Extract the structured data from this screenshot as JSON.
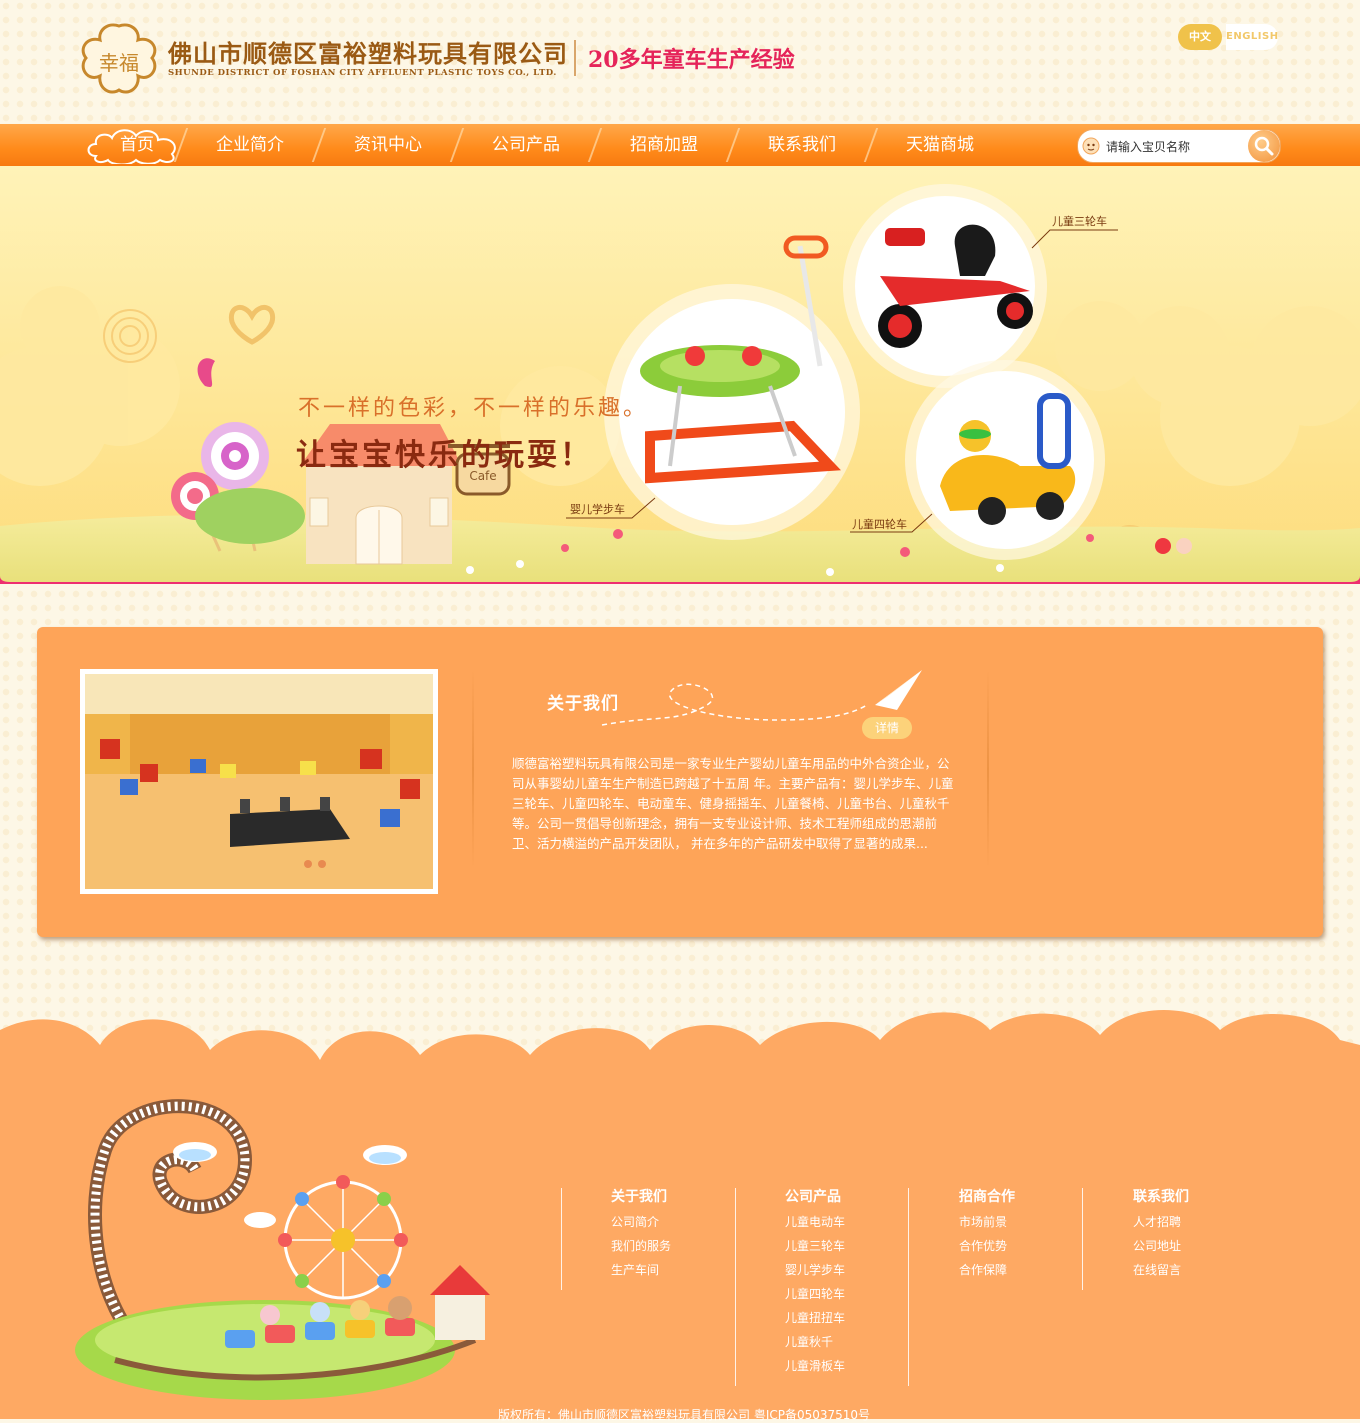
{
  "header": {
    "logo_text": "幸福",
    "company_cn": "佛山市顺德区富裕塑料玩具有限公司",
    "company_en": "SHUNDE DISTRICT OF FOSHAN CITY AFFLUENT PLASTIC TOYS CO., LTD.",
    "slogan": "20多年童车生产经验",
    "lang_cn": "中文",
    "lang_en": "ENGLISH"
  },
  "nav": {
    "items": [
      "首页",
      "企业简介",
      "资讯中心",
      "公司产品",
      "招商加盟",
      "联系我们",
      "天猫商城"
    ],
    "active_index": 0,
    "search_placeholder": "请输入宝贝名称"
  },
  "banner": {
    "line1": "不一样的色彩，不一样的乐趣。",
    "line2": "让宝宝快乐的玩耍！",
    "cafe_sign": "Cafe",
    "labels": {
      "tricycle": "儿童三轮车",
      "walker": "婴儿学步车",
      "four_wheel": "儿童四轮车"
    },
    "active_slide": 0,
    "slide_count": 2
  },
  "about": {
    "title": "关于我们",
    "detail_button": "详情",
    "text": "顺德富裕塑料玩具有限公司是一家专业生产婴幼儿童车用品的中外合资企业，公司从事婴幼儿童车生产制造已跨越了十五周 年。主要产品有：婴儿学步车、儿童三轮车、儿童四轮车、电动童车、健身摇摇车、儿童餐椅、儿童书台、儿童秋千等。公司一贯倡导创新理念，拥有一支专业设计师、技术工程师组成的思潮前卫、活力横溢的产品开发团队， 并在多年的产品研发中取得了显著的成果..."
  },
  "footer": {
    "columns": [
      {
        "title": "关于我们",
        "links": [
          "公司简介",
          "我们的服务",
          "生产车间"
        ]
      },
      {
        "title": "公司产品",
        "links": [
          "儿童电动车",
          "儿童三轮车",
          "婴儿学步车",
          "儿童四轮车",
          "儿童扭扭车",
          "儿童秋千",
          "儿童滑板车"
        ]
      },
      {
        "title": "招商合作",
        "links": [
          "市场前景",
          "合作优势",
          "合作保障"
        ]
      },
      {
        "title": "联系我们",
        "links": [
          "人才招聘",
          "公司地址",
          "在线留言"
        ]
      }
    ],
    "copyright": "版权所有：佛山市顺德区富裕塑料玩具有限公司 粤ICP备05037510号"
  },
  "colors": {
    "nav_orange": "#ff8a1a",
    "about_bg": "#fea458",
    "footer_bg": "#fea963",
    "slogan_pink": "#e5245a",
    "brand_brown": "#9a5a14"
  }
}
